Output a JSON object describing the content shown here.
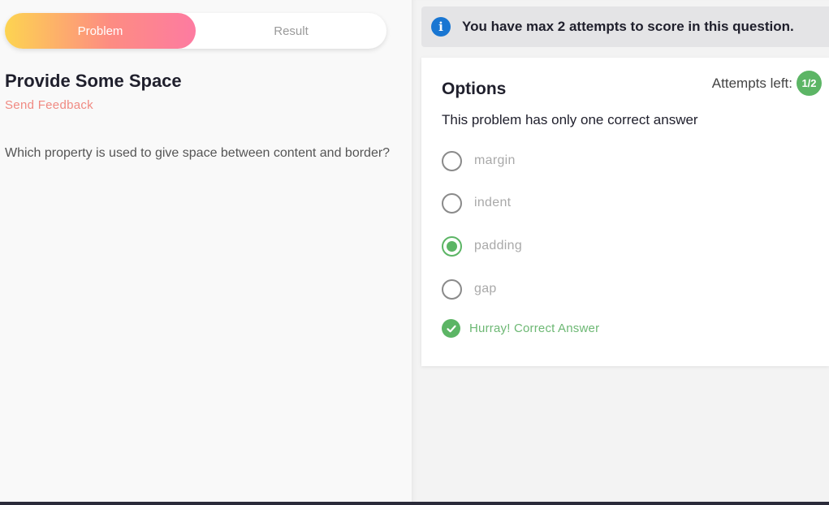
{
  "tabs": [
    {
      "label": "Problem",
      "active": true
    },
    {
      "label": "Result",
      "active": false
    }
  ],
  "problem": {
    "title": "Provide Some Space",
    "feedback_link": "Send Feedback",
    "question": "Which property is used to give space between content and border?"
  },
  "banner": {
    "icon": "info-icon",
    "glyph": "i",
    "text": "You have max 2 attempts to score in this question."
  },
  "options_panel": {
    "title": "Options",
    "attempts_label": "Attempts left:",
    "attempts_value": "1/2",
    "subtitle": "This problem has only one correct answer",
    "options": [
      {
        "label": "margin",
        "selected": false
      },
      {
        "label": "indent",
        "selected": false
      },
      {
        "label": "padding",
        "selected": true
      },
      {
        "label": "gap",
        "selected": false
      }
    ],
    "result_text": "Hurray! Correct Answer"
  },
  "colors": {
    "accent_green": "#5cb565",
    "info_blue": "#1976d2",
    "feedback_pink": "#f08a82",
    "tab_gradient_start": "#fdd451",
    "tab_gradient_end": "#fd7ba1"
  }
}
